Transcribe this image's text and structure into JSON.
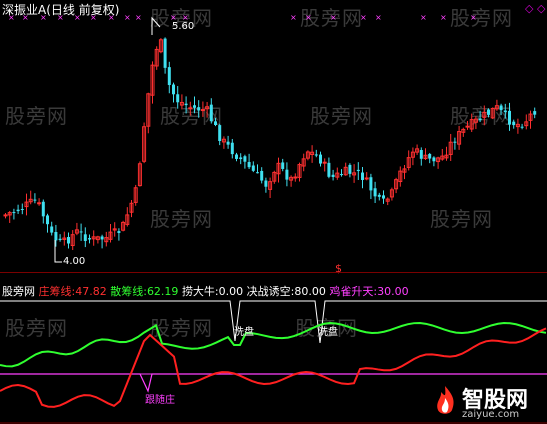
{
  "header": {
    "title": "深振业A(日线 前复权)"
  },
  "upper": {
    "high_label": "5.60",
    "low_label": "4.00",
    "mid_marker": "$",
    "controls": [
      "◇",
      "◇"
    ]
  },
  "indicators": {
    "name": "股旁网",
    "items": [
      {
        "label": "庄筹线:",
        "value": "47.82",
        "color": "#ff3030"
      },
      {
        "label": "散筹线:",
        "value": "62.19",
        "color": "#30ff30"
      },
      {
        "label": "捞大牛:",
        "value": "0.00",
        "color": "#ffffff"
      },
      {
        "label": "决战诱空:",
        "value": "80.00",
        "color": "#ffffff"
      },
      {
        "label": "鸡雀升天:",
        "value": "30.00",
        "color": "#ff40ff"
      }
    ]
  },
  "lower": {
    "notes": [
      "洗盘",
      "洗盘",
      "跟随庄"
    ]
  },
  "watermarks": [
    "股旁网",
    "股旁网",
    "股旁网",
    "股旁网",
    "股旁网",
    "股旁网",
    "股旁网",
    "股旁网",
    "股旁网",
    "股旁网",
    "股旁网",
    "股旁网"
  ],
  "brand": {
    "name": "智股网",
    "url": "zaiyue.com"
  },
  "colors": {
    "up": "#ff3030",
    "down": "#40e0f0",
    "green_line": "#30ff30",
    "red_line": "#ff2020",
    "magenta": "#ff40ff"
  }
}
